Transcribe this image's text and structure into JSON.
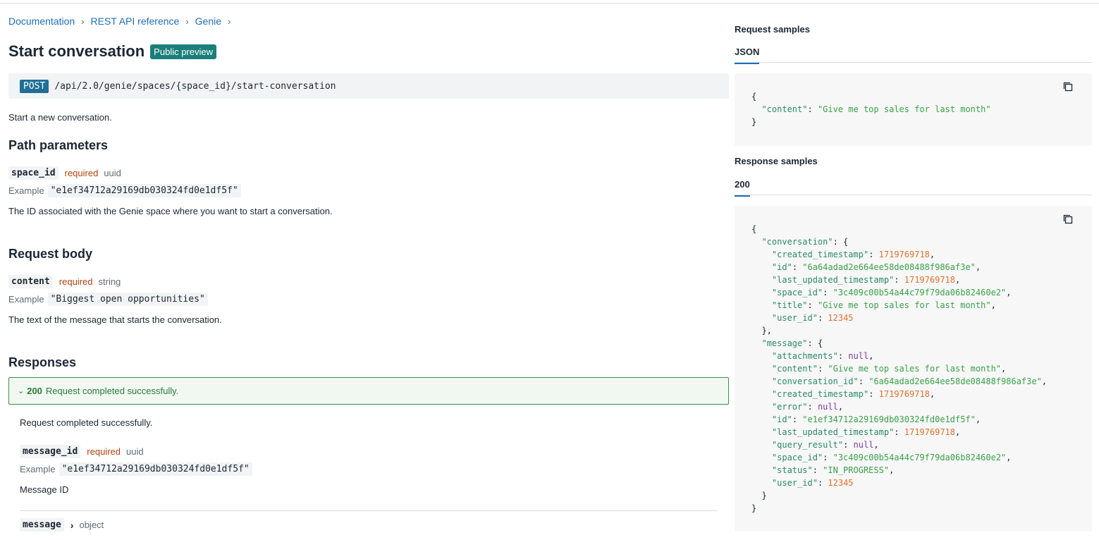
{
  "breadcrumb": [
    "Documentation",
    "REST API reference",
    "Genie"
  ],
  "page": {
    "title": "Start conversation",
    "badge": "Public preview",
    "method": "POST",
    "path": "/api/2.0/genie/spaces/{space_id}/start-conversation",
    "description": "Start a new conversation."
  },
  "path_params": {
    "heading": "Path parameters",
    "name": "space_id",
    "required": "required",
    "type": "uuid",
    "example_label": "Example",
    "example": "\"e1ef34712a29169db030324fd0e1df5f\"",
    "description": "The ID associated with the Genie space where you want to start a conversation."
  },
  "request_body": {
    "heading": "Request body",
    "name": "content",
    "required": "required",
    "type": "string",
    "example_label": "Example",
    "example": "\"Biggest open opportunities\"",
    "description": "The text of the message that starts the conversation."
  },
  "responses": {
    "heading": "Responses",
    "code": "200",
    "message": "Request completed successfully.",
    "body_text": "Request completed successfully.",
    "param_name": "message_id",
    "param_required": "required",
    "param_type": "uuid",
    "example_label": "Example",
    "example": "\"e1ef34712a29169db030324fd0e1df5f\"",
    "param_description": "Message ID",
    "next_name": "message",
    "next_type": "object"
  },
  "request_samples": {
    "heading": "Request samples",
    "tab": "JSON",
    "lines": [
      [
        [
          "p",
          "{"
        ]
      ],
      [
        [
          "p",
          "  "
        ],
        [
          "k",
          "\"content\""
        ],
        [
          "p",
          ": "
        ],
        [
          "s",
          "\"Give me top sales for last month\""
        ]
      ],
      [
        [
          "p",
          "}"
        ]
      ]
    ]
  },
  "response_samples": {
    "heading": "Response samples",
    "tab": "200",
    "lines": [
      [
        [
          "p",
          "{"
        ]
      ],
      [
        [
          "p",
          "  "
        ],
        [
          "k",
          "\"conversation\""
        ],
        [
          "p",
          ": {"
        ]
      ],
      [
        [
          "p",
          "    "
        ],
        [
          "k",
          "\"created_timestamp\""
        ],
        [
          "p",
          ": "
        ],
        [
          "n",
          "1719769718"
        ],
        [
          "p",
          ","
        ]
      ],
      [
        [
          "p",
          "    "
        ],
        [
          "k",
          "\"id\""
        ],
        [
          "p",
          ": "
        ],
        [
          "s",
          "\"6a64adad2e664ee58de08488f986af3e\""
        ],
        [
          "p",
          ","
        ]
      ],
      [
        [
          "p",
          "    "
        ],
        [
          "k",
          "\"last_updated_timestamp\""
        ],
        [
          "p",
          ": "
        ],
        [
          "n",
          "1719769718"
        ],
        [
          "p",
          ","
        ]
      ],
      [
        [
          "p",
          "    "
        ],
        [
          "k",
          "\"space_id\""
        ],
        [
          "p",
          ": "
        ],
        [
          "s",
          "\"3c409c00b54a44c79f79da06b82460e2\""
        ],
        [
          "p",
          ","
        ]
      ],
      [
        [
          "p",
          "    "
        ],
        [
          "k",
          "\"title\""
        ],
        [
          "p",
          ": "
        ],
        [
          "s",
          "\"Give me top sales for last month\""
        ],
        [
          "p",
          ","
        ]
      ],
      [
        [
          "p",
          "    "
        ],
        [
          "k",
          "\"user_id\""
        ],
        [
          "p",
          ": "
        ],
        [
          "n",
          "12345"
        ]
      ],
      [
        [
          "p",
          "  },"
        ]
      ],
      [
        [
          "p",
          "  "
        ],
        [
          "k",
          "\"message\""
        ],
        [
          "p",
          ": {"
        ]
      ],
      [
        [
          "p",
          "    "
        ],
        [
          "k",
          "\"attachments\""
        ],
        [
          "p",
          ": "
        ],
        [
          "l",
          "null"
        ],
        [
          "p",
          ","
        ]
      ],
      [
        [
          "p",
          "    "
        ],
        [
          "k",
          "\"content\""
        ],
        [
          "p",
          ": "
        ],
        [
          "s",
          "\"Give me top sales for last month\""
        ],
        [
          "p",
          ","
        ]
      ],
      [
        [
          "p",
          "    "
        ],
        [
          "k",
          "\"conversation_id\""
        ],
        [
          "p",
          ": "
        ],
        [
          "s",
          "\"6a64adad2e664ee58de08488f986af3e\""
        ],
        [
          "p",
          ","
        ]
      ],
      [
        [
          "p",
          "    "
        ],
        [
          "k",
          "\"created_timestamp\""
        ],
        [
          "p",
          ": "
        ],
        [
          "n",
          "1719769718"
        ],
        [
          "p",
          ","
        ]
      ],
      [
        [
          "p",
          "    "
        ],
        [
          "k",
          "\"error\""
        ],
        [
          "p",
          ": "
        ],
        [
          "l",
          "null"
        ],
        [
          "p",
          ","
        ]
      ],
      [
        [
          "p",
          "    "
        ],
        [
          "k",
          "\"id\""
        ],
        [
          "p",
          ": "
        ],
        [
          "s",
          "\"e1ef34712a29169db030324fd0e1df5f\""
        ],
        [
          "p",
          ","
        ]
      ],
      [
        [
          "p",
          "    "
        ],
        [
          "k",
          "\"last_updated_timestamp\""
        ],
        [
          "p",
          ": "
        ],
        [
          "n",
          "1719769718"
        ],
        [
          "p",
          ","
        ]
      ],
      [
        [
          "p",
          "    "
        ],
        [
          "k",
          "\"query_result\""
        ],
        [
          "p",
          ": "
        ],
        [
          "l",
          "null"
        ],
        [
          "p",
          ","
        ]
      ],
      [
        [
          "p",
          "    "
        ],
        [
          "k",
          "\"space_id\""
        ],
        [
          "p",
          ": "
        ],
        [
          "s",
          "\"3c409c00b54a44c79f79da06b82460e2\""
        ],
        [
          "p",
          ","
        ]
      ],
      [
        [
          "p",
          "    "
        ],
        [
          "k",
          "\"status\""
        ],
        [
          "p",
          ": "
        ],
        [
          "s",
          "\"IN_PROGRESS\""
        ],
        [
          "p",
          ","
        ]
      ],
      [
        [
          "p",
          "    "
        ],
        [
          "k",
          "\"user_id\""
        ],
        [
          "p",
          ": "
        ],
        [
          "n",
          "12345"
        ]
      ],
      [
        [
          "p",
          "  }"
        ]
      ],
      [
        [
          "p",
          "}"
        ]
      ]
    ]
  },
  "icons": {
    "copy": "copy-icon",
    "chevron_down": "chevron-down-icon",
    "chevron_right": "chevron-right-icon"
  },
  "colors": {
    "link": "#1d6fb8",
    "badge": "#1a7f7a",
    "method": "#1f6f96",
    "required": "#b3410b",
    "success": "#2b7a3b",
    "json_key": "#2b8a6a",
    "json_string": "#3aa14a",
    "json_number": "#e0702a",
    "json_null": "#7a3d9e"
  }
}
